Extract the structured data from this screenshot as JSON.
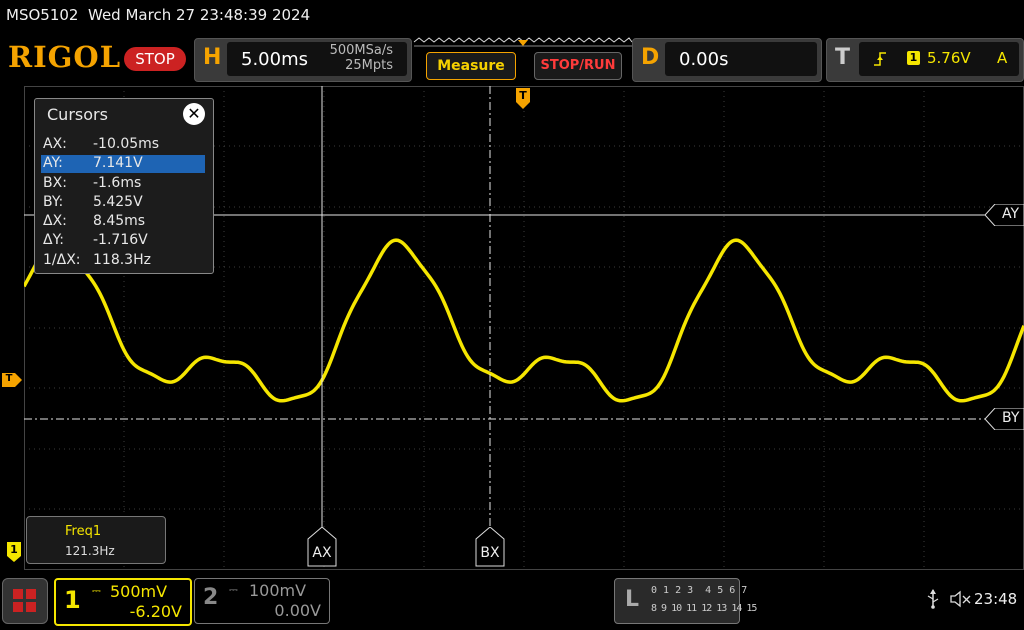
{
  "title_bar": {
    "model": "MSO5102",
    "datetime": "Wed March 27 23:48:39 2024"
  },
  "header": {
    "logo": "RIGOL",
    "run_state": "STOP",
    "horizontal": {
      "letter": "H",
      "timebase": "5.00ms",
      "sample_rate": "500MSa/s",
      "memory_depth": "25Mpts"
    },
    "measure_label": "Measure",
    "stop_run_label": "STOP/RUN",
    "delay": {
      "letter": "D",
      "value": "0.00s"
    },
    "trigger": {
      "letter": "T",
      "source_badge": "1",
      "level": "5.76V",
      "mode": "A"
    }
  },
  "cursors_panel": {
    "title": "Cursors",
    "rows": [
      {
        "key": "AX:",
        "value": "-10.05ms"
      },
      {
        "key": "AY:",
        "value": "7.141V",
        "selected": true
      },
      {
        "key": "BX:",
        "value": "-1.6ms"
      },
      {
        "key": "BY:",
        "value": "5.425V"
      },
      {
        "key": "ΔX:",
        "value": "8.45ms"
      },
      {
        "key": "ΔY:",
        "value": "-1.716V"
      },
      {
        "key": "1/ΔX:",
        "value": "118.3Hz"
      }
    ]
  },
  "cursor_labels": {
    "ay": "AY",
    "by": "BY",
    "ax": "AX",
    "bx": "BX"
  },
  "markers": {
    "trigger_pos": "T",
    "trigger_level": "T",
    "ch1_ground": "1"
  },
  "measurement": {
    "name": "Freq1",
    "value": "121.3Hz"
  },
  "channels": [
    {
      "number": "1",
      "scale": "500mV",
      "offset": "-6.20V",
      "active": true,
      "color": "#f5e600"
    },
    {
      "number": "2",
      "scale": "100mV",
      "offset": "0.00V",
      "active": false,
      "color": "#888888"
    }
  ],
  "logic_panel": {
    "letter": "L",
    "row1": "0 1 2 3  4 5 6 7",
    "row2": "8 9 10 11 12 13 14 15"
  },
  "status": {
    "time": "23:48"
  },
  "colors": {
    "accent": "#f5a300",
    "waveform": "#f5e600",
    "selection": "#1e64b4",
    "stop": "#cc2222"
  },
  "icons": [
    "usb-icon",
    "speaker-muted-icon",
    "close-icon",
    "logic-analyzer-icon"
  ]
}
